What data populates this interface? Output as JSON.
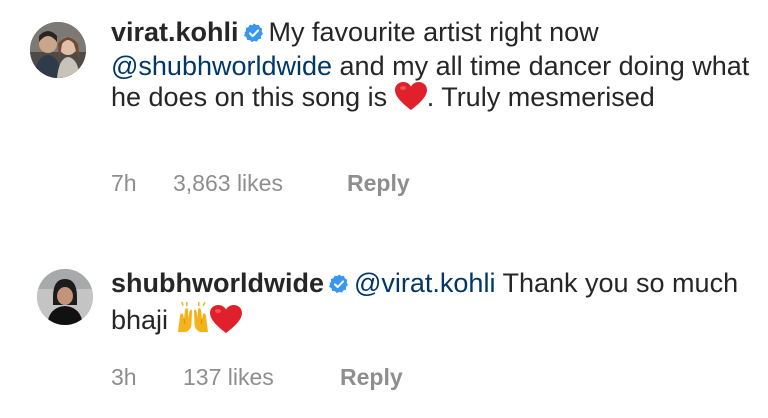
{
  "comments": [
    {
      "username": "virat.kohli",
      "verified": true,
      "parts": {
        "before_mention": "My favourite artist right now",
        "mention": "@shubhworldwide",
        "after_mention": " and my all time dancer doing what he does on this song is ",
        "after_emoji": ". Truly mesmerised"
      },
      "emoji": [
        "red-heart"
      ],
      "time": "7h",
      "likes": "3,863 likes",
      "reply_label": "Reply"
    },
    {
      "username": "shubhworldwide",
      "verified": true,
      "parts": {
        "mention": "@virat.kohli",
        "after_mention": " Thank you so much bhaji "
      },
      "emoji": [
        "raising-hands",
        "red-heart"
      ],
      "time": "3h",
      "likes": "137 likes",
      "reply_label": "Reply"
    }
  ],
  "colors": {
    "text": "#262626",
    "mention": "#00376b",
    "meta": "#8e8e8e",
    "verified": "#3897f0",
    "heart": "#e0212b"
  }
}
